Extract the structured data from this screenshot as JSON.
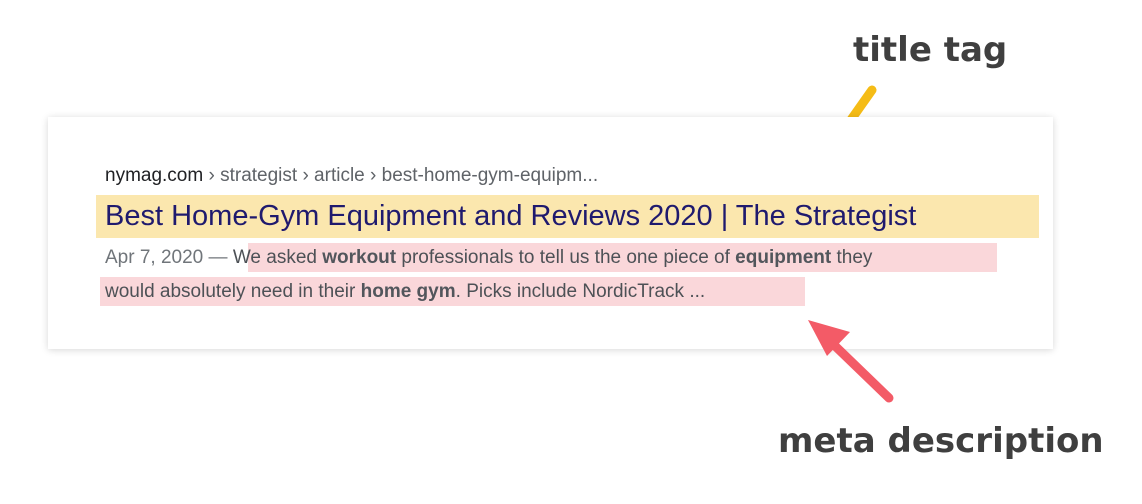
{
  "annotations": {
    "title_label": "title tag",
    "meta_label": "meta description",
    "title_arrow_color": "#f5bc16",
    "meta_arrow_color": "#f35b67"
  },
  "result": {
    "breadcrumb": {
      "domain": "nymag.com",
      "path": " › strategist › article › best-home-gym-equipm..."
    },
    "title": "Best Home-Gym Equipment and Reviews 2020 | The Strategist",
    "date": "Apr 7, 2020 —",
    "description": {
      "line1": {
        "t1": "We asked ",
        "b1": "workout",
        "t2": " professionals to tell us the one piece of ",
        "b2": "equipment",
        "t3": " they"
      },
      "line2": {
        "t1": "would absolutely need in their ",
        "b1": "home gym",
        "t2": ". Picks include NordicTrack ..."
      }
    },
    "colors": {
      "title_highlight": "#fbe7ae",
      "description_highlight": "#fad7da",
      "title_text": "#1f1a6e"
    }
  }
}
